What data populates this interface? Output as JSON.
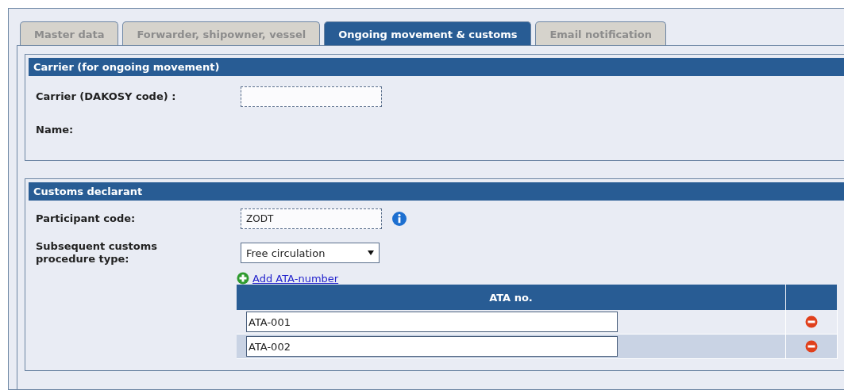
{
  "tabs": [
    {
      "label": "Master data",
      "selected": false
    },
    {
      "label": "Forwarder, shipowner, vessel",
      "selected": false
    },
    {
      "label": "Ongoing movement & customs",
      "selected": true
    },
    {
      "label": "Email notification",
      "selected": false
    }
  ],
  "carrier_section": {
    "title": "Carrier (for ongoing movement)",
    "fields": [
      {
        "kind": "input",
        "label": "Carrier (DAKOSY code) :"
      },
      {
        "kind": "text",
        "label": "Name:"
      }
    ]
  },
  "customs_section": {
    "title": "Customs declarant",
    "participant_code": {
      "label": "Participant code:",
      "value": "ZODT"
    },
    "procedure_type": {
      "label": "Subsequent customs procedure type:",
      "value": "Free circulation"
    },
    "add_link": "Add ATA-number",
    "table": {
      "columns": [
        "ATA no."
      ],
      "rows": [
        {
          "value": "ATA-001"
        },
        {
          "value": "ATA-002"
        }
      ]
    }
  }
}
